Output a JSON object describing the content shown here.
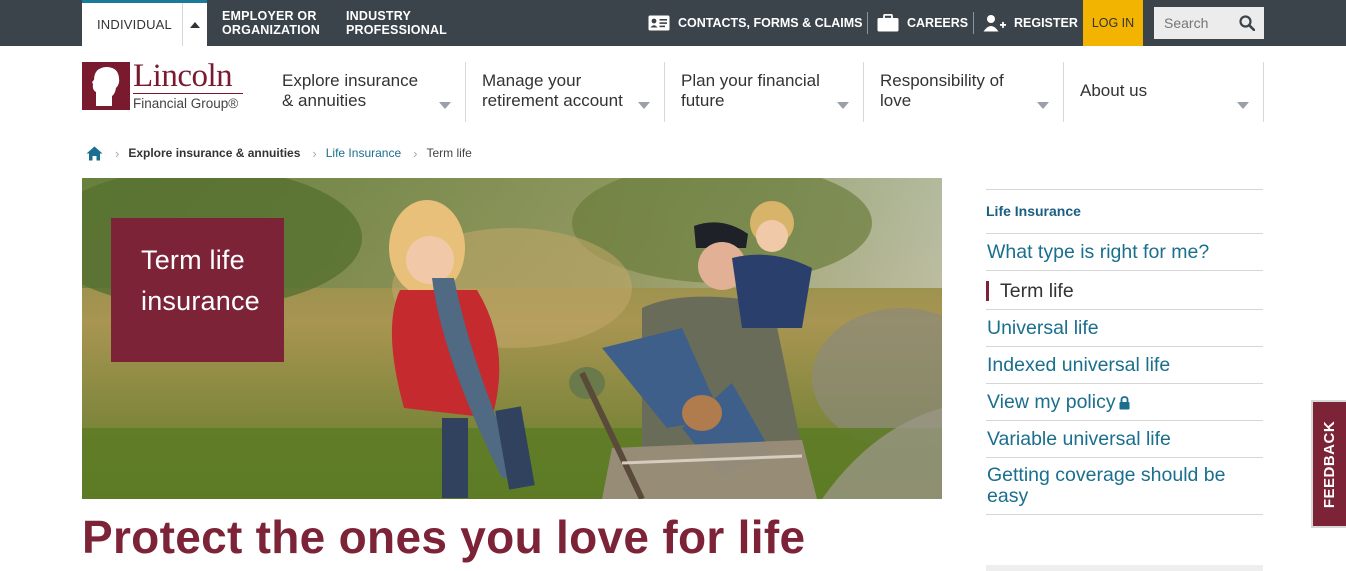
{
  "topbar": {
    "audience_tabs": [
      "INDIVIDUAL",
      "EMPLOYER OR\nORGANIZATION",
      "INDUSTRY\nPROFESSIONAL"
    ],
    "employer_line1": "EMPLOYER OR",
    "employer_line2": "ORGANIZATION",
    "industry_line1": "INDUSTRY",
    "industry_line2": "PROFESSIONAL",
    "contacts_label": "CONTACTS, FORMS & CLAIMS",
    "careers_label": "CAREERS",
    "register_label": "REGISTER",
    "login_label": "LOG IN",
    "search_placeholder": "Search",
    "login_color": "#f2b400",
    "bar_color": "#3b434b"
  },
  "logo": {
    "wordmark": "Lincoln",
    "subline": "Financial Group®"
  },
  "nav": {
    "items": [
      {
        "line1": "Explore insurance",
        "line2": "& annuities"
      },
      {
        "line1": "Manage your",
        "line2": "retirement account"
      },
      {
        "line1": "Plan your financial",
        "line2": "future"
      },
      {
        "line1": "Responsibility of",
        "line2": "love"
      },
      {
        "line1": "About us",
        "line2": ""
      }
    ]
  },
  "breadcrumb": {
    "home_icon": "home-icon",
    "level1": "Explore insurance & annuities",
    "level2": "Life Insurance",
    "current": "Term life"
  },
  "hero": {
    "box_line1": "Term life",
    "box_line2": "insurance",
    "accent_color": "#7d2337"
  },
  "headline": "Protect the ones you love for life",
  "side_menu": {
    "heading": "Life Insurance",
    "items": [
      "What type is right for me?",
      "Term life",
      "Universal life",
      "Indexed universal life",
      "View my policy",
      "Variable universal life",
      "Getting coverage should be easy"
    ],
    "item7_line1": "Getting coverage should be",
    "item7_line2": "easy",
    "active_item": "Term life"
  },
  "feedback_label": "FEEDBACK"
}
